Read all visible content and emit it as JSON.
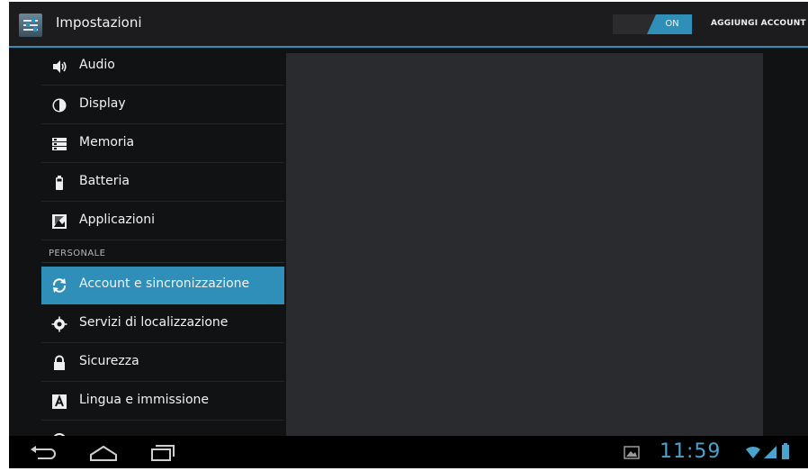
{
  "actionbar": {
    "title": "Impostazioni",
    "switch_label": "ON",
    "add_account_label": "AGGIUNGI ACCOUNT"
  },
  "settings": {
    "items_top": [
      {
        "label": "Audio",
        "icon": "volume-icon"
      },
      {
        "label": "Display",
        "icon": "brightness-icon"
      },
      {
        "label": "Memoria",
        "icon": "storage-icon"
      },
      {
        "label": "Batteria",
        "icon": "battery-icon"
      },
      {
        "label": "Applicazioni",
        "icon": "apps-icon"
      }
    ],
    "section_personal": "PERSONALE",
    "items_personal": [
      {
        "label": "Account e sincronizzazione",
        "icon": "sync-icon",
        "selected": true
      },
      {
        "label": "Servizi di localizzazione",
        "icon": "location-icon"
      },
      {
        "label": "Sicurezza",
        "icon": "lock-icon"
      },
      {
        "label": "Lingua e immissione",
        "icon": "language-icon"
      }
    ]
  },
  "statusbar": {
    "time": "11:59"
  },
  "colors": {
    "accent": "#2f8fb8",
    "background": "#111214",
    "detail_pane": "#2a2b2e"
  }
}
